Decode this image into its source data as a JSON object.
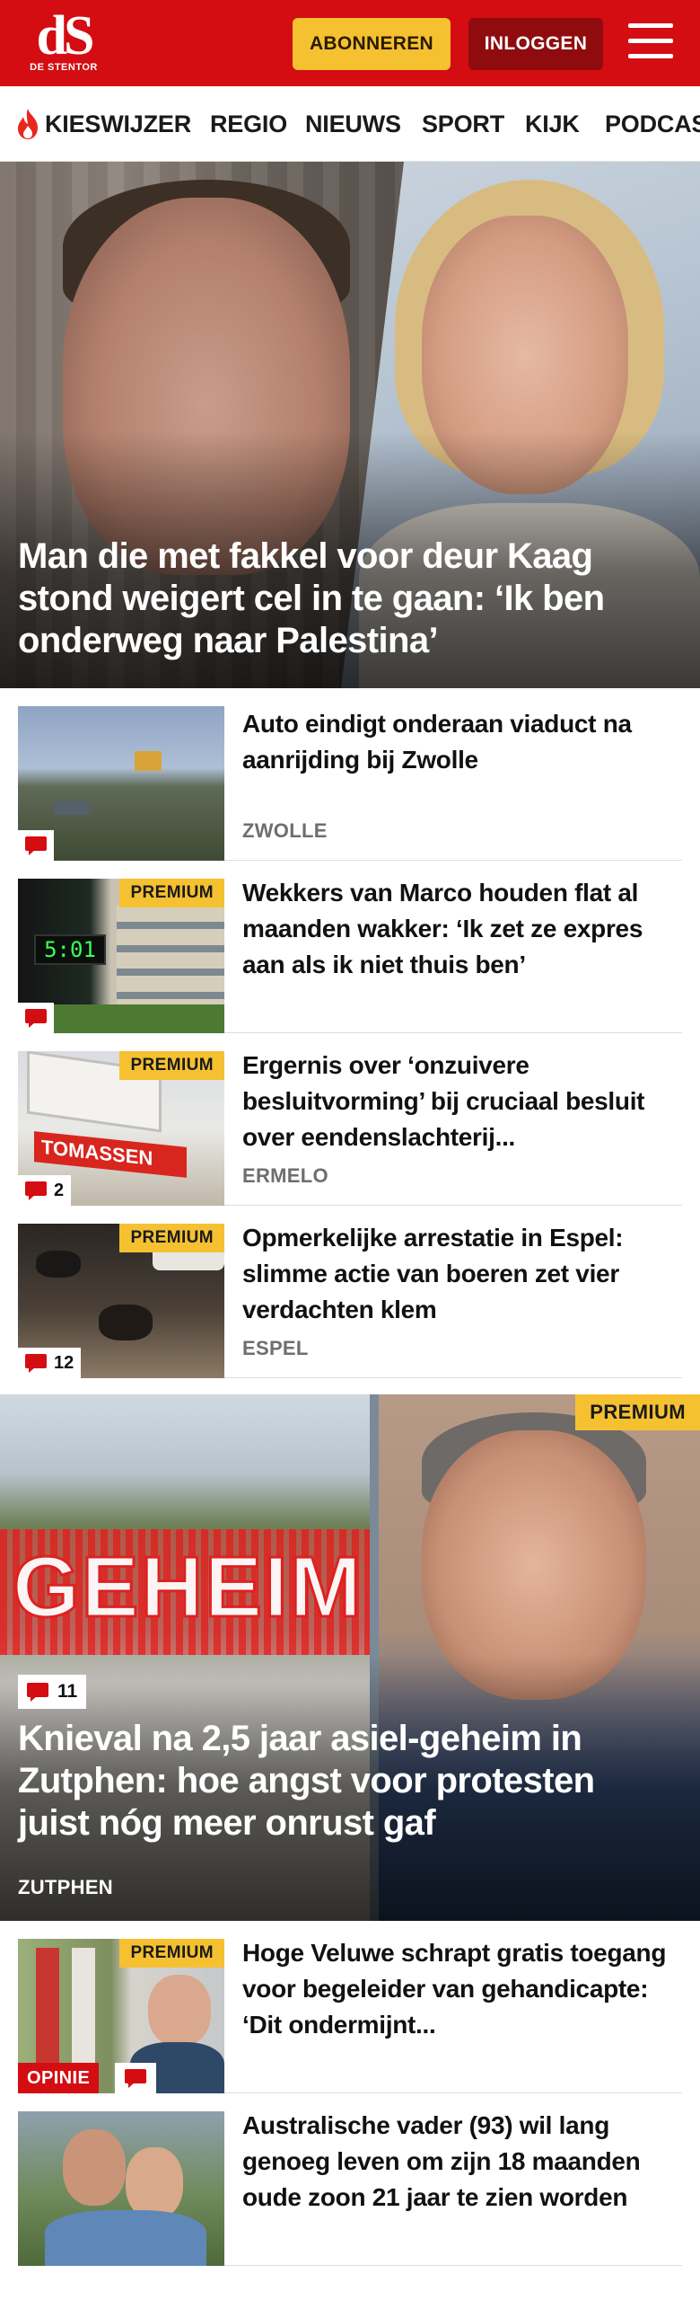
{
  "header": {
    "logo_mark": "dS",
    "logo_text": "DE STENTOR",
    "subscribe_label": "ABONNEREN",
    "login_label": "INLOGGEN",
    "menu_icon": "hamburger-menu-icon",
    "brand_color": "#d40d12",
    "subscribe_color": "#f5c131",
    "login_color": "#8f0b0e"
  },
  "nav": {
    "items": [
      {
        "label": "KIESWIJZER",
        "icon": "flame-icon"
      },
      {
        "label": "REGIO"
      },
      {
        "label": "NIEUWS"
      },
      {
        "label": "SPORT"
      },
      {
        "label": "KIJK"
      },
      {
        "label": "PODCAS"
      }
    ]
  },
  "hero": {
    "title": "Man die met fakkel voor deur Kaag stond weigert cel in te gaan: ‘Ik ben onderweg naar Palestina’"
  },
  "articles": [
    {
      "title": "Auto eindigt onderaan viaduct na aanrijding bij Zwolle",
      "location": "ZWOLLE",
      "premium": "",
      "comments": ""
    },
    {
      "title": "Wekkers van Marco houden flat al maanden wakker: ‘Ik zet ze expres aan als ik niet thuis ben’",
      "location": "",
      "premium": "PREMIUM",
      "comments": ""
    },
    {
      "title": "Ergernis over ‘onzuivere besluitvorming’ bij cruciaal besluit over eendenslachterij...",
      "location": "ERMELO",
      "premium": "PREMIUM",
      "comments": "2"
    },
    {
      "title": "Opmerkelijke arrestatie in Espel: slimme actie van boeren zet vier verdachten klem",
      "location": "ESPEL",
      "premium": "PREMIUM",
      "comments": "12"
    }
  ],
  "feature": {
    "title": "Knieval na 2,5 jaar asiel-geheim in Zutphen: hoe angst voor protesten juist nóg meer onrust gaf",
    "location": "ZUTPHEN",
    "premium": "PREMIUM",
    "comments": "11",
    "image_text": "GEHEIM"
  },
  "articles2": [
    {
      "title": "Hoge Veluwe schrapt gratis toegang voor begeleider van gehandicapte: ‘Dit ondermijnt...",
      "premium": "PREMIUM",
      "tag": "OPINIE"
    },
    {
      "title": "Australische vader (93) wil lang genoeg leven om zijn 18 maanden oude zoon 21 jaar te zien worden",
      "premium": ""
    }
  ],
  "thumb_text": {
    "clock": "5:01",
    "sign": "TOMASSEN"
  }
}
